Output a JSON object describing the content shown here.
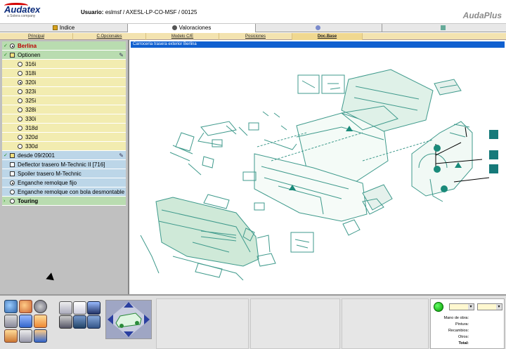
{
  "header": {
    "logo_text": "Audatex",
    "logo_sub": "a Solera company",
    "user_label": "Usuario:",
    "user_value": "eslmsf / AXESL-LP-CO-MSF / 00125",
    "brand": "AudaPlus"
  },
  "tabs": [
    {
      "label": "Indice",
      "state": "normal"
    },
    {
      "label": "Valoraciones",
      "state": "active"
    },
    {
      "label": "",
      "state": "dim"
    },
    {
      "label": "",
      "state": "dim"
    }
  ],
  "subtabs": [
    "Principal",
    "C.Opcionales",
    "Modelo C/E",
    "Posiciones",
    "Doc.Base"
  ],
  "subtabs_selected": "Doc.Base",
  "tree": {
    "berlina": "Berlina",
    "optionen": "Optionen",
    "models": [
      "316i",
      "318i",
      "320i",
      "323i",
      "325i",
      "328i",
      "330i",
      "318d",
      "320d",
      "330d"
    ],
    "selected_model": "320i",
    "desde": "desde 09/2001",
    "options": [
      {
        "label": "Deflector trasero M-Technic II  [716]",
        "type": "checkbox",
        "checked": false
      },
      {
        "label": "Spoiler trasero M-Technic",
        "type": "checkbox",
        "checked": false
      },
      {
        "label": "Enganche remolque fijo",
        "type": "radio",
        "checked": true
      },
      {
        "label": "Enganche remolque con bola desmontable",
        "type": "radio",
        "checked": false
      }
    ],
    "touring": "Touring"
  },
  "diagram": {
    "title": "Carrocería trasera exterior Berlina",
    "accent": "#3f9a8c",
    "tile_color": "#167a7a"
  },
  "totals": {
    "labels": [
      "Mano de obra:",
      "Pintura:",
      "Recambios:",
      "Otros:",
      "Total:"
    ]
  },
  "colors": {
    "selection_bar": "#1060d0",
    "tree_green": "#b9dcb0",
    "tree_yellow": "#f2ecb0",
    "tree_blue": "#bcd6e8"
  },
  "toolbar_icons": [
    "zoom-in-icon",
    "search-parts-icon",
    "settings-gear-icon",
    "calculate-icon",
    "document-icon",
    "info-icon",
    "edit-icon",
    "camera-icon",
    "save-icon",
    "grid-icon",
    "printer-icon",
    "cart-icon"
  ]
}
